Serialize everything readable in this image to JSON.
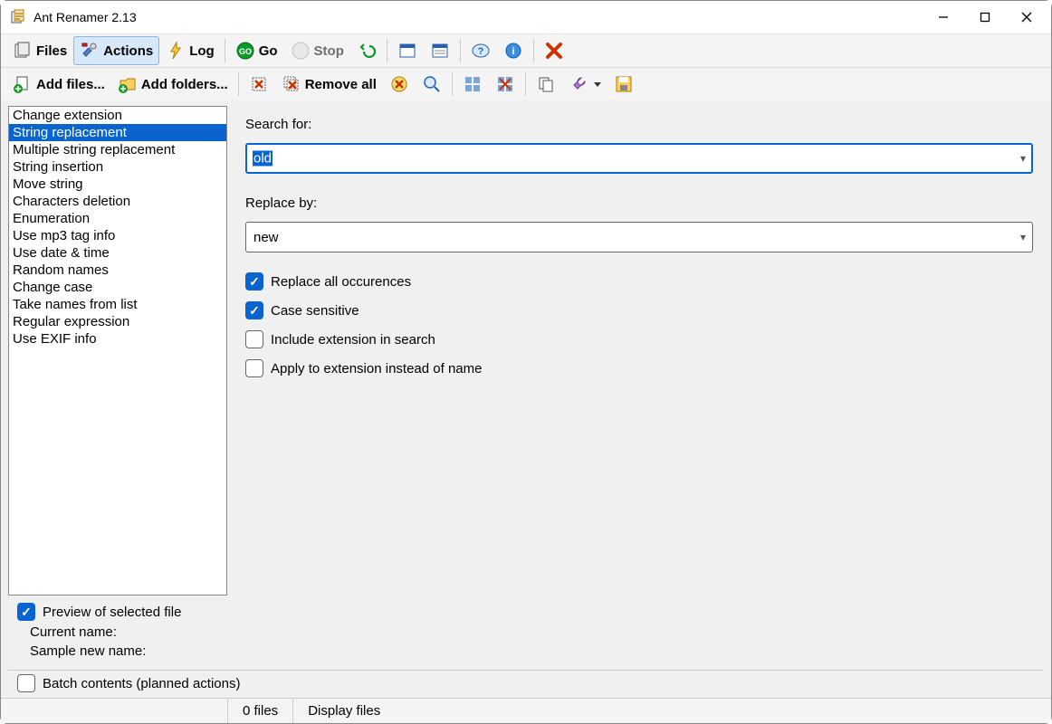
{
  "window": {
    "title": "Ant Renamer 2.13"
  },
  "toolbar1": {
    "files": "Files",
    "actions": "Actions",
    "log": "Log",
    "go": "Go",
    "stop": "Stop"
  },
  "toolbar2": {
    "add_files": "Add files...",
    "add_folders": "Add folders...",
    "remove_all": "Remove all"
  },
  "operations": [
    "Change extension",
    "String replacement",
    "Multiple string replacement",
    "String insertion",
    "Move string",
    "Characters deletion",
    "Enumeration",
    "Use mp3 tag info",
    "Use date & time",
    "Random names",
    "Change case",
    "Take names from list",
    "Regular expression",
    "Use EXIF info"
  ],
  "operations_selected_index": 1,
  "panel": {
    "search_label": "Search for:",
    "search_value": "old",
    "replace_label": "Replace by:",
    "replace_value": "new",
    "chk_replace_all": "Replace all occurences",
    "chk_case": "Case sensitive",
    "chk_include_ext": "Include extension in search",
    "chk_apply_ext": "Apply to extension instead of name",
    "checked": {
      "replace_all": true,
      "case": true,
      "include_ext": false,
      "apply_ext": false
    }
  },
  "preview": {
    "chk_label": "Preview of selected file",
    "checked": true,
    "current_label": "Current name:",
    "current_value": "",
    "sample_label": "Sample new name:",
    "sample_value": ""
  },
  "batch": {
    "chk_label": "Batch contents (planned actions)",
    "checked": false
  },
  "status": {
    "files": "0 files",
    "display": "Display files"
  }
}
